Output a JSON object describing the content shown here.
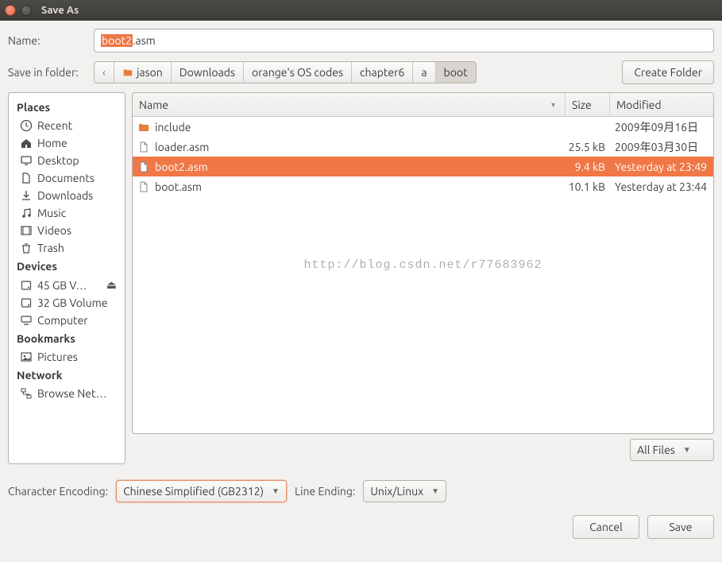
{
  "window": {
    "title": "Save As"
  },
  "name_row": {
    "label": "Name:",
    "value_selected": "boot2",
    "value_rest": ".asm"
  },
  "folder_row": {
    "label": "Save in folder:",
    "back_glyph": "‹",
    "segments": [
      "jason",
      "Downloads",
      "orange's OS codes",
      "chapter6",
      "a",
      "boot"
    ],
    "create_folder": "Create Folder"
  },
  "sidebar": {
    "places_head": "Places",
    "places": [
      {
        "label": "Recent",
        "icon": "clock-icon"
      },
      {
        "label": "Home",
        "icon": "home-icon"
      },
      {
        "label": "Desktop",
        "icon": "desktop-icon"
      },
      {
        "label": "Documents",
        "icon": "document-icon"
      },
      {
        "label": "Downloads",
        "icon": "download-icon"
      },
      {
        "label": "Music",
        "icon": "music-icon"
      },
      {
        "label": "Videos",
        "icon": "video-icon"
      },
      {
        "label": "Trash",
        "icon": "trash-icon"
      }
    ],
    "devices_head": "Devices",
    "devices": [
      {
        "label": "45 GB V…",
        "icon": "drive-icon",
        "eject": true
      },
      {
        "label": "32 GB Volume",
        "icon": "drive-icon"
      },
      {
        "label": "Computer",
        "icon": "computer-icon"
      }
    ],
    "bookmarks_head": "Bookmarks",
    "bookmarks": [
      {
        "label": "Pictures",
        "icon": "pictures-icon"
      }
    ],
    "network_head": "Network",
    "network": [
      {
        "label": "Browse Net…",
        "icon": "network-icon"
      }
    ]
  },
  "fileview": {
    "headers": {
      "name": "Name",
      "size": "Size",
      "modified": "Modified"
    },
    "rows": [
      {
        "name": "include",
        "type": "folder",
        "size": "",
        "modified": "2009年09月16日",
        "selected": false
      },
      {
        "name": "loader.asm",
        "type": "file",
        "size": "25.5 kB",
        "modified": "2009年03月30日",
        "selected": false
      },
      {
        "name": "boot2.asm",
        "type": "file",
        "size": "9.4 kB",
        "modified": "Yesterday at 23:49",
        "selected": true
      },
      {
        "name": "boot.asm",
        "type": "file",
        "size": "10.1 kB",
        "modified": "Yesterday at 23:44",
        "selected": false
      }
    ],
    "watermark": "http://blog.csdn.net/r77683962"
  },
  "filter": {
    "current": "All Files"
  },
  "encoding": {
    "label": "Character Encoding:",
    "current": "Chinese Simplified (GB2312)"
  },
  "line_ending": {
    "label": "Line Ending:",
    "current": "Unix/Linux"
  },
  "actions": {
    "cancel": "Cancel",
    "save": "Save"
  }
}
